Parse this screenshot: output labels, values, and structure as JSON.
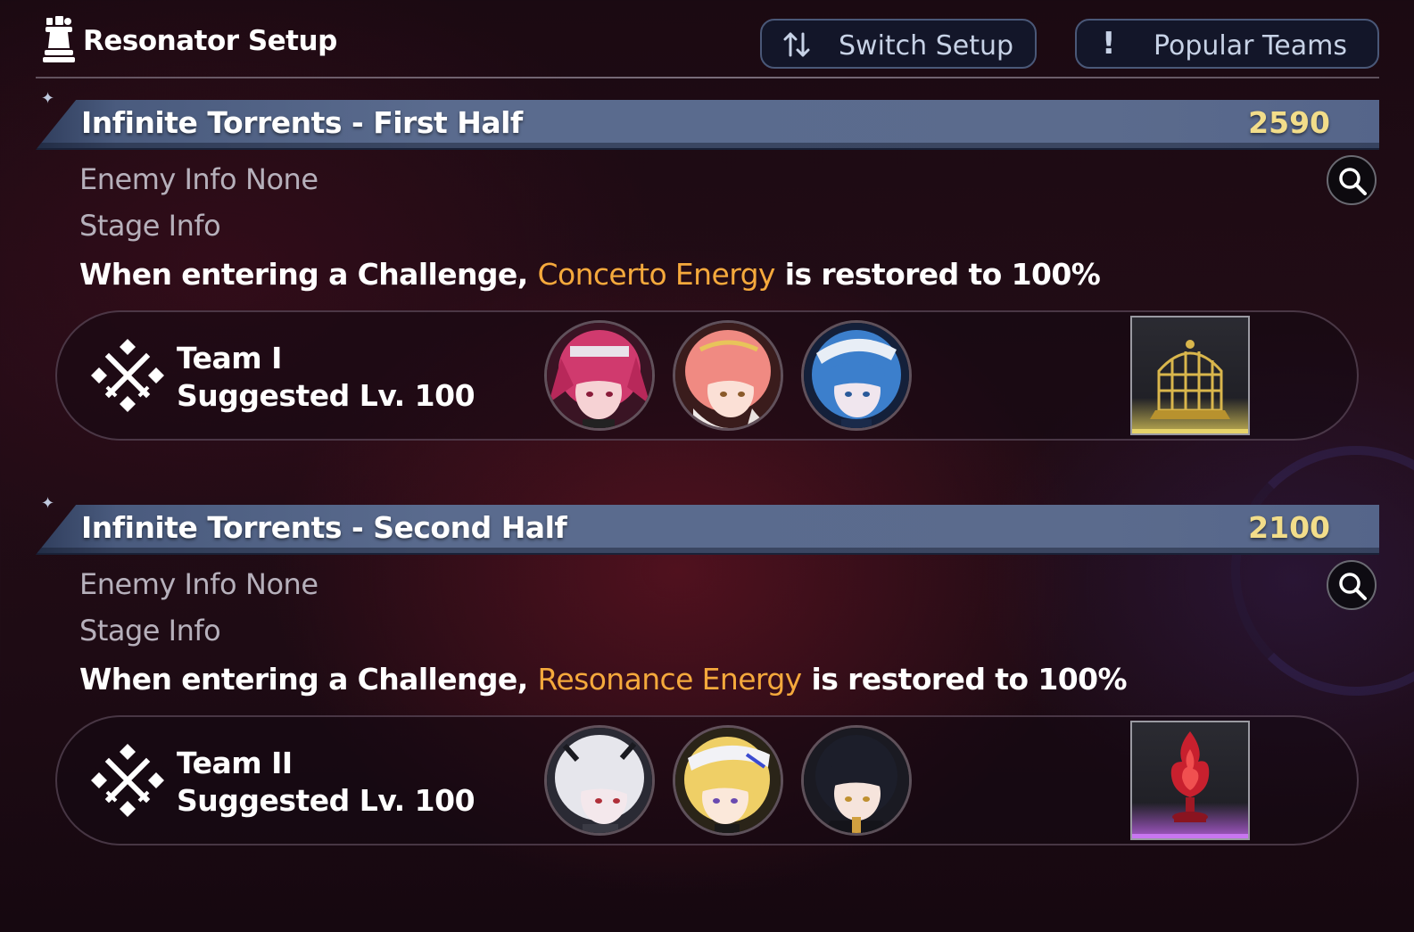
{
  "header": {
    "title": "Resonator Setup",
    "switch_label": "Switch Setup",
    "popular_label": "Popular Teams"
  },
  "sections": [
    {
      "stage_title": "Infinite Torrents - First Half",
      "score": "2590",
      "enemy_label": "Enemy Info",
      "enemy_value": "None",
      "stage_label": "Stage Info",
      "effect_prefix": "When entering a Challenge,",
      "effect_highlight": "Concerto Energy",
      "effect_suffix": "is restored to 100%",
      "team_name": "Team I",
      "suggested_level": "Suggested Lv. 100",
      "echo_rarity": "gold"
    },
    {
      "stage_title": "Infinite Torrents - Second Half",
      "score": "2100",
      "enemy_label": "Enemy Info",
      "enemy_value": "None",
      "stage_label": "Stage Info",
      "effect_prefix": "When entering a Challenge,",
      "effect_highlight": "Resonance Energy",
      "effect_suffix": "is restored to 100%",
      "team_name": "Team II",
      "suggested_level": "Suggested Lv. 100",
      "echo_rarity": "purple"
    }
  ],
  "icons": {
    "header": "chess-pieces-icon",
    "switch": "swap-arrows-icon",
    "popular": "exclamation-icon",
    "search": "search-icon",
    "team": "crossed-swords-emblem-icon"
  },
  "colors": {
    "highlight": "#f5a93c",
    "score": "#f2dd8a",
    "stage_bar": "#5a6b8e",
    "rarity_gold": "#dcc85a",
    "rarity_purple": "#be64e6"
  }
}
